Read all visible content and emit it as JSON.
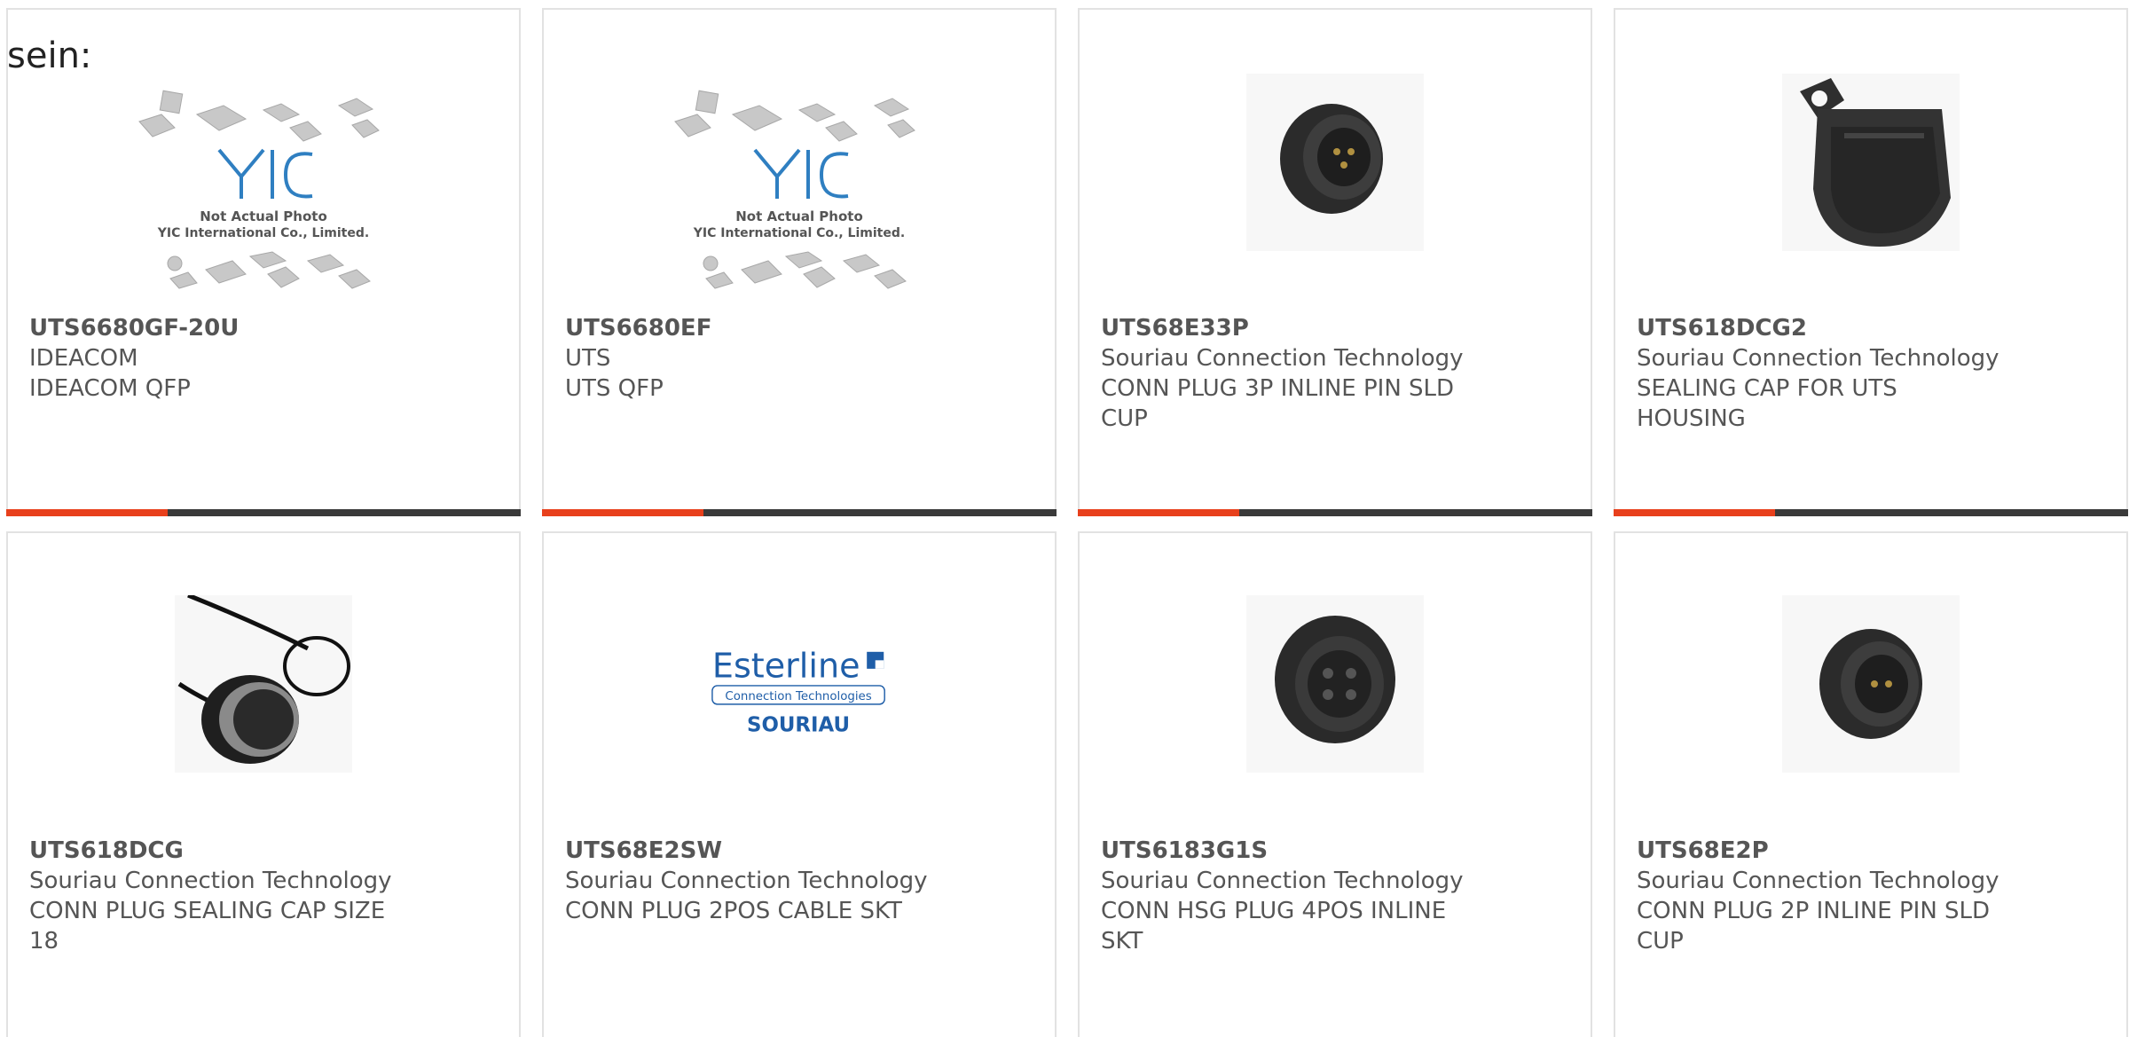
{
  "intro_text": "sein:",
  "colors": {
    "accent": "#e8401c",
    "bar": "#3a3a3a",
    "border": "#e2e2e2",
    "text": "#555555"
  },
  "products": [
    {
      "part_number": "UTS6680GF-20U",
      "manufacturer": "IDEACOM",
      "description": "IDEACOM QFP",
      "image": "not-actual-photo-placeholder",
      "image_text": {
        "logo": "YIC",
        "line1": "Not Actual Photo",
        "line2": "YIC International Co., Limited."
      }
    },
    {
      "part_number": "UTS6680EF",
      "manufacturer": "UTS",
      "description": "UTS QFP",
      "image": "not-actual-photo-placeholder",
      "image_text": {
        "logo": "YIC",
        "line1": "Not Actual Photo",
        "line2": "YIC International Co., Limited."
      }
    },
    {
      "part_number": "UTS68E33P",
      "manufacturer": "Souriau Connection Technology",
      "description": "CONN PLUG 3P INLINE PIN SLD CUP",
      "image": "connector-plug-photo"
    },
    {
      "part_number": "UTS618DCG2",
      "manufacturer": "Souriau Connection Technology",
      "description": "SEALING CAP FOR UTS HOUSING",
      "image": "sealing-cap-photo"
    },
    {
      "part_number": "UTS618DCG",
      "manufacturer": "Souriau Connection Technology",
      "description": "CONN PLUG SEALING CAP SIZE 18",
      "image": "sealing-cap-lanyard-photo"
    },
    {
      "part_number": "UTS68E2SW",
      "manufacturer": "Souriau Connection Technology",
      "description": "CONN PLUG 2POS CABLE SKT",
      "image": "esterline-logo",
      "image_text": {
        "logo": "Esterline",
        "line1": "Connection Technologies",
        "line2": "SOURIAU"
      }
    },
    {
      "part_number": "UTS6183G1S",
      "manufacturer": "Souriau Connection Technology",
      "description": "CONN HSG PLUG 4POS INLINE SKT",
      "image": "connector-socket-photo"
    },
    {
      "part_number": "UTS68E2P",
      "manufacturer": "Souriau Connection Technology",
      "description": "CONN PLUG 2P INLINE PIN SLD CUP",
      "image": "connector-plug-photo"
    }
  ]
}
